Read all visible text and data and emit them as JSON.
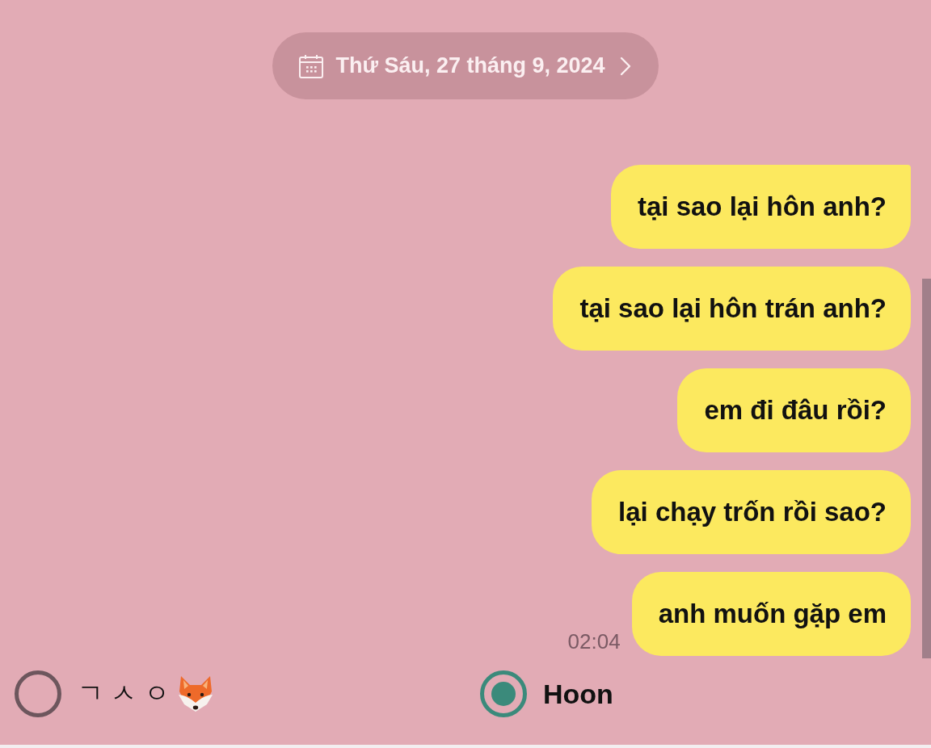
{
  "date_header": {
    "label": "Thứ Sáu, 27 tháng 9, 2024"
  },
  "messages": [
    {
      "text": "tại sao lại hôn anh?",
      "tail": true
    },
    {
      "text": "tại sao lại hôn trán anh?",
      "tail": false
    },
    {
      "text": "em đi đâu rồi?",
      "tail": false
    },
    {
      "text": "lại chạy trốn rồi sao?",
      "tail": false
    },
    {
      "text": "anh muốn gặp em",
      "tail": false,
      "time": "02:04"
    }
  ],
  "participants": [
    {
      "name": "ㄱ ㅅ ㅇ",
      "kind": "emoji",
      "selected": false
    },
    {
      "name": "Hoon",
      "kind": "plain",
      "selected": true
    }
  ]
}
